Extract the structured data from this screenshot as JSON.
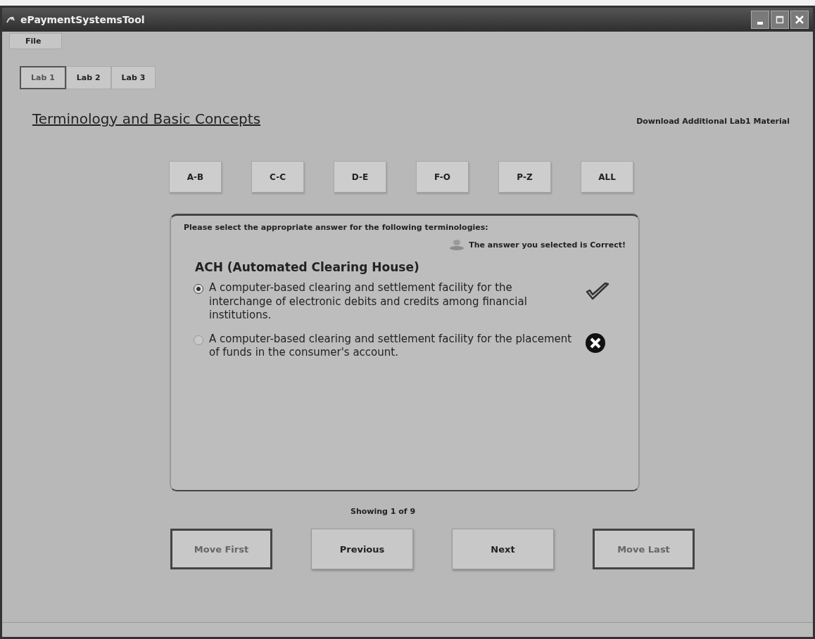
{
  "window": {
    "title": "ePaymentSystemsTool"
  },
  "menu": [
    "File"
  ],
  "tabs": [
    {
      "label": "Lab 1",
      "selected": true
    },
    {
      "label": "Lab 2",
      "selected": false
    },
    {
      "label": "Lab 3",
      "selected": false
    }
  ],
  "heading": "Terminology and Basic Concepts",
  "download_link": "Download Additional Lab1 Material",
  "filters": [
    "A-B",
    "C-C",
    "D-E",
    "F-O",
    "P-Z",
    "ALL"
  ],
  "quiz": {
    "instruction": "Please select the appropriate answer for the following terminologies:",
    "feedback": "The answer you selected is Correct!",
    "term": "ACH (Automated Clearing House)",
    "options": [
      {
        "text": "A computer-based clearing and settlement facility for the interchange of electronic debits and credits among financial institutions.",
        "selected": true,
        "kind": "correct"
      },
      {
        "text": "A computer-based clearing and settlement facility for the placement of funds in the consumer's account.",
        "selected": false,
        "kind": "wrong"
      }
    ]
  },
  "status": "Showing 1 of 9",
  "nav_buttons": [
    {
      "label": "Move First",
      "disabled": true
    },
    {
      "label": "Previous",
      "disabled": false
    },
    {
      "label": "Next",
      "disabled": false
    },
    {
      "label": "Move Last",
      "disabled": true
    }
  ]
}
